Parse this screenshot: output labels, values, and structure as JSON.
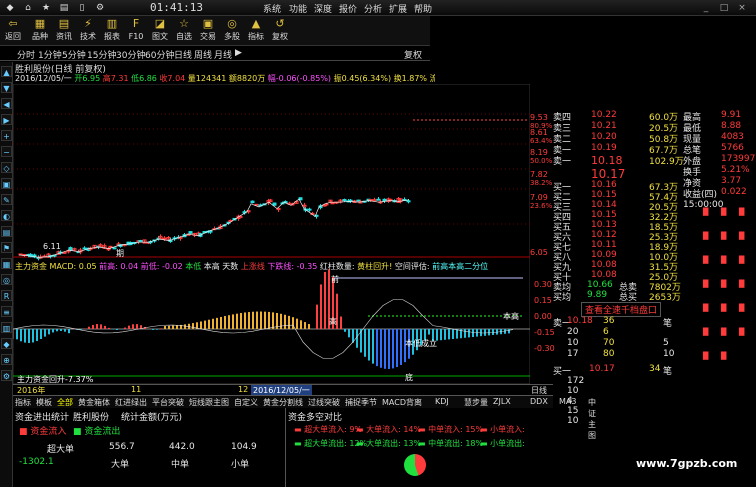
{
  "titlebar": {
    "clock": "01:41:13",
    "menus": [
      "系统",
      "功能",
      "深度",
      "报价",
      "分析",
      "扩展",
      "帮助"
    ]
  },
  "toolbar": {
    "buttons": [
      {
        "icon": "back-icon",
        "label": "返回"
      },
      {
        "icon": "grid-icon",
        "label": "品种"
      },
      {
        "icon": "newspaper-icon",
        "label": "资讯"
      },
      {
        "icon": "lightning-icon",
        "label": "技术"
      },
      {
        "icon": "table-icon",
        "label": "报表"
      },
      {
        "icon": "f10-icon",
        "label": "F10"
      },
      {
        "icon": "palette-icon",
        "label": "图文"
      },
      {
        "icon": "star-icon",
        "label": "自选"
      },
      {
        "icon": "cart-icon",
        "label": "交易"
      },
      {
        "icon": "people-icon",
        "label": "多股"
      },
      {
        "icon": "indicator-icon",
        "label": "指标"
      },
      {
        "icon": "replay-icon",
        "label": "复权"
      }
    ]
  },
  "periods": [
    "分时",
    "1分钟",
    "5分钟",
    "15分钟",
    "30分钟",
    "60分钟",
    "日线",
    "周线",
    "月线",
    "▶"
  ],
  "period_right": "复权",
  "stock": {
    "title": "胜利股份(日线 前复权)",
    "info": [
      {
        "t": "2016/12/05/一",
        "c": "wht"
      },
      {
        "t": "开6.95",
        "c": "grn"
      },
      {
        "t": "高7.31",
        "c": "red"
      },
      {
        "t": "低6.86",
        "c": "grn"
      },
      {
        "t": "收7.04",
        "c": "red"
      },
      {
        "t": "量124341",
        "c": "yel"
      },
      {
        "t": "额8820万",
        "c": "yel"
      },
      {
        "t": "幅-0.06(-0.85%)",
        "c": "mag"
      },
      {
        "t": "振0.45(6.34%)",
        "c": "yel"
      },
      {
        "t": "换1.87%",
        "c": "yel"
      },
      {
        "t": "流通6.66亿",
        "c": "yel"
      },
      {
        "t": "供气热",
        "c": "yel"
      }
    ]
  },
  "price_axis": [
    {
      "v": "9.53",
      "p": "80.9%"
    },
    {
      "v": "8.61",
      "p": "63.4%"
    },
    {
      "v": "8.19",
      "p": "50.0%"
    },
    {
      "v": "7.82",
      "p": "38.2%"
    },
    {
      "v": "7.09",
      "p": "23.6%"
    },
    {
      "v": "6.05",
      "p": ""
    }
  ],
  "chart_labels": {
    "low": "6.11",
    "flag": "期"
  },
  "indicator": {
    "items": [
      {
        "t": "主力资金 MACD: 0.05",
        "c": "yel"
      },
      {
        "t": "前高: 0.04",
        "c": "mag"
      },
      {
        "t": "前低: -0.02",
        "c": "mag"
      },
      {
        "t": "本低",
        "c": "grn"
      },
      {
        "t": "本高",
        "c": "wht"
      },
      {
        "t": "天数",
        "c": "wht"
      },
      {
        "t": "上涨线",
        "c": "red"
      },
      {
        "t": "下跌线: -0.35",
        "c": "mag"
      },
      {
        "t": "红柱数量:",
        "c": "wht"
      },
      {
        "t": "黄柱回升!",
        "c": "yel"
      },
      {
        "t": "空间评估:",
        "c": "wht"
      },
      {
        "t": "前高本高二分位",
        "c": "cyn"
      }
    ],
    "axis": [
      "0.30",
      "0.15",
      "0.00",
      "-0.15",
      "-0.30"
    ],
    "labels": {
      "qian": "前",
      "gao": "高",
      "high": "本高",
      "low": "本低成立",
      "di": "底",
      "bottom": "主力资金回升-7.37%"
    }
  },
  "date_row": {
    "items": [
      "2016年",
      "11",
      "12",
      "2016/12/05/一"
    ],
    "right": "日线"
  },
  "quote": {
    "header": [
      {
        "l": "卖四",
        "v": "10.22",
        "s": "60.0万"
      },
      {
        "l": "卖三",
        "v": "10.21",
        "s": "20.5万"
      },
      {
        "l": "卖二",
        "v": "10.20",
        "s": "50.8万"
      },
      {
        "l": "卖一",
        "v": "10.19",
        "s": "67.7万"
      }
    ],
    "trade": {
      "l": "卖一",
      "v": "10.18",
      "s": "102.9万"
    },
    "cur": "10.17",
    "bids": [
      {
        "l": "买一",
        "v": "10.16",
        "s": "67.3万"
      },
      {
        "l": "买二",
        "v": "10.15",
        "s": "57.4万"
      },
      {
        "l": "买三",
        "v": "10.14",
        "s": "20.5万"
      },
      {
        "l": "买四",
        "v": "10.15",
        "s": "32.2万"
      },
      {
        "l": "买五",
        "v": "10.13",
        "s": "18.5万"
      },
      {
        "l": "买六",
        "v": "10.12",
        "s": "25.3万"
      },
      {
        "l": "买七",
        "v": "10.11",
        "s": "18.9万"
      },
      {
        "l": "买八",
        "v": "10.09",
        "s": "10.0万"
      },
      {
        "l": "买九",
        "v": "10.08",
        "s": "31.5万"
      },
      {
        "l": "买十",
        "v": "10.08",
        "s": "25.0万"
      }
    ],
    "stats": [
      {
        "l": "卖均",
        "v": "10.66",
        "k": "总卖",
        "s": "7802万"
      },
      {
        "l": "买均",
        "v": "9.89",
        "k": "总买",
        "s": "2653万"
      }
    ],
    "link": "查看全速千档盘口",
    "right_col": [
      {
        "l": "最高",
        "v": "9.91"
      },
      {
        "l": "最低",
        "v": "8.88"
      },
      {
        "l": "现量",
        "v": "4083"
      },
      {
        "l": "总笔",
        "v": "5766"
      },
      {
        "l": "外盘",
        "v": "173997"
      },
      {
        "l": "换手",
        "v": "5.21%"
      },
      {
        "l": "净资",
        "v": "3.77"
      },
      {
        "l": "收益(四)",
        "v": "0.022"
      }
    ],
    "time": "15:00:00",
    "ticks": [
      {
        "p": "10.18",
        "n": "36",
        "t": "笔"
      },
      {
        "p": "20",
        "n": "6",
        "t": ""
      },
      {
        "p": "10",
        "n": "70",
        "t": "5"
      },
      {
        "p": "17",
        "n": "80",
        "t": "10"
      }
    ],
    "buy1": {
      "l": "买一",
      "p": "10.17",
      "n": "34",
      "t": "笔"
    },
    "small": [
      "172",
      "10",
      "4",
      "15",
      "10"
    ]
  },
  "bottom_tabs": [
    "指标",
    "模板",
    "全部",
    "黄金箱体",
    "红进绿出",
    "平台突破",
    "短线跟主图",
    "自定义",
    "黄金分割线",
    "过线突破",
    "捕捉季节",
    "MACD背离",
    "KDJ",
    "慧步量",
    "ZJLX",
    "DDX",
    "MA3",
    "中证主图"
  ],
  "flow": {
    "title": "资金进出统计",
    "tabs": [
      "胜利股份",
      "统计金额(万元)"
    ],
    "legend": [
      {
        "t": "资金流入",
        "c": "red"
      },
      {
        "t": "资金流出",
        "c": "grn"
      }
    ],
    "rows": [
      {
        "t": "超大单",
        "v": [
          "556.7",
          "442.0",
          "104.9"
        ]
      }
    ],
    "neg": "-1302.1",
    "cols": [
      "大单",
      "中单",
      "小单"
    ]
  },
  "duel": {
    "title": "资金多空对比",
    "rows": [
      [
        {
          "t": "超大单流入: 9%",
          "c": "red"
        },
        {
          "t": "大单流入: 14%",
          "c": "red"
        },
        {
          "t": "中单流入: 15%",
          "c": "red"
        },
        {
          "t": "小单流入:",
          "c": "red"
        }
      ],
      [
        {
          "t": "超大单流出: 12%",
          "c": "grn"
        },
        {
          "t": "大单流出: 13%",
          "c": "grn"
        },
        {
          "t": "中单流出: 18%",
          "c": "grn"
        },
        {
          "t": "小单流出:",
          "c": "grn"
        }
      ]
    ]
  },
  "watermark": "www.7gpzb.com",
  "colors": {
    "up": "#ff3b3b",
    "down": "#1fe0e0",
    "ma": "#f0f0f0"
  }
}
